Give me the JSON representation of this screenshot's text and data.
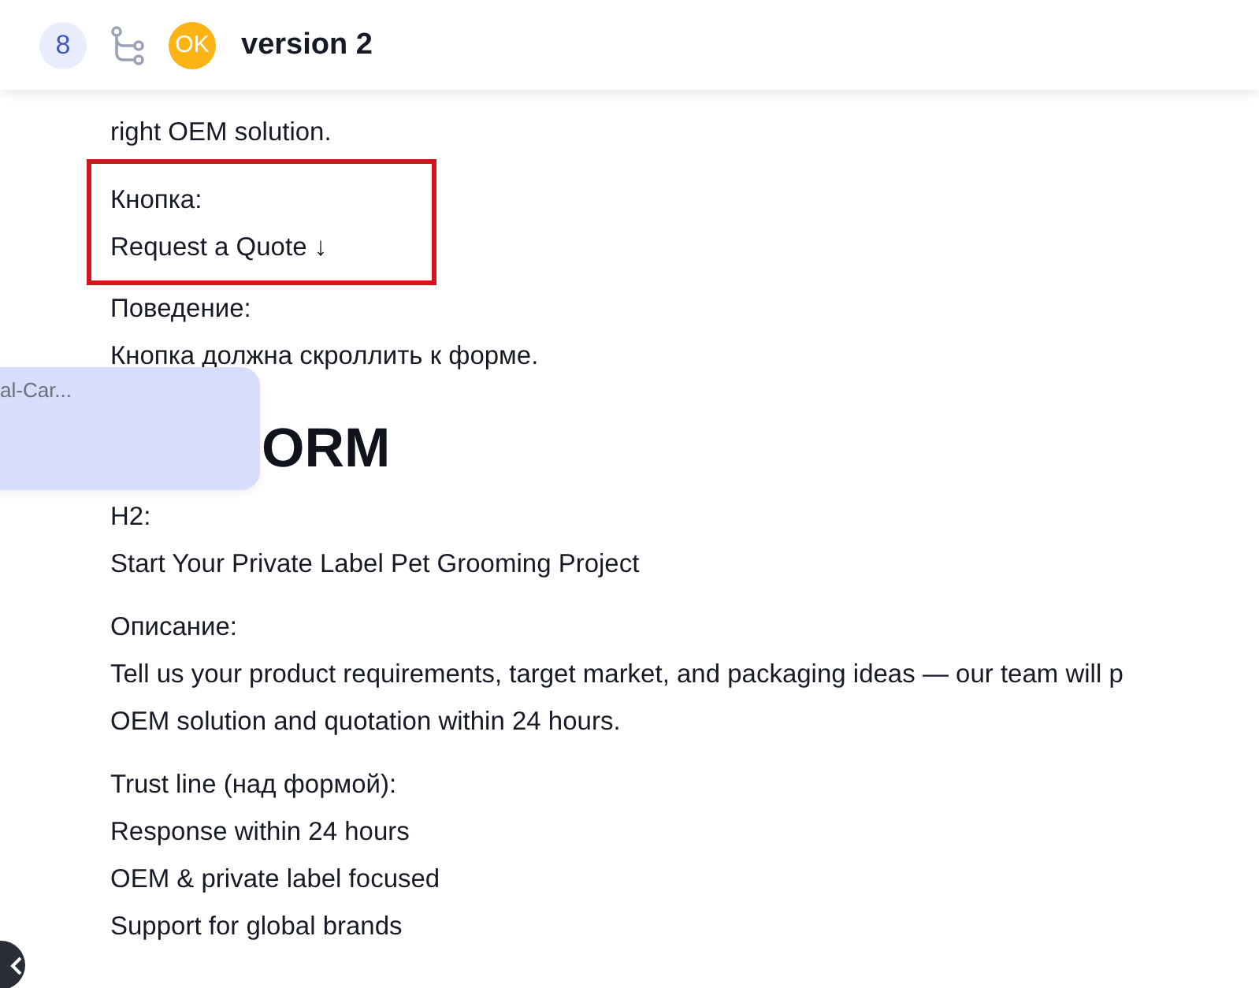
{
  "header": {
    "count_badge": "8",
    "avatar": "OK",
    "title": "version 2"
  },
  "blocks": [
    {
      "kind": "line",
      "text": "right OEM solution."
    },
    {
      "kind": "highlight",
      "lines": [
        "Кнопка:",
        "Request a Quote ↓"
      ]
    },
    {
      "kind": "line",
      "text": "Поведение:"
    },
    {
      "kind": "line",
      "text": "Кнопка должна скроллить к форме."
    },
    {
      "kind": "heading",
      "text": "ORM"
    },
    {
      "kind": "line",
      "text": "H2:"
    },
    {
      "kind": "line",
      "text": "Start Your Private Label Pet Grooming Project"
    },
    {
      "kind": "gap"
    },
    {
      "kind": "line",
      "text": "Описание:"
    },
    {
      "kind": "line",
      "text": "Tell us your product requirements, target market, and packaging ideas — our team will p"
    },
    {
      "kind": "line",
      "text": "OEM solution and quotation within 24 hours."
    },
    {
      "kind": "gap"
    },
    {
      "kind": "line",
      "text": "Trust line (над формой):"
    },
    {
      "kind": "line",
      "text": "Response within 24 hours"
    },
    {
      "kind": "line",
      "text": "OEM & private label focused"
    },
    {
      "kind": "line",
      "text": "Support for global brands"
    }
  ],
  "floating_card": {
    "text": "al-Car..."
  }
}
